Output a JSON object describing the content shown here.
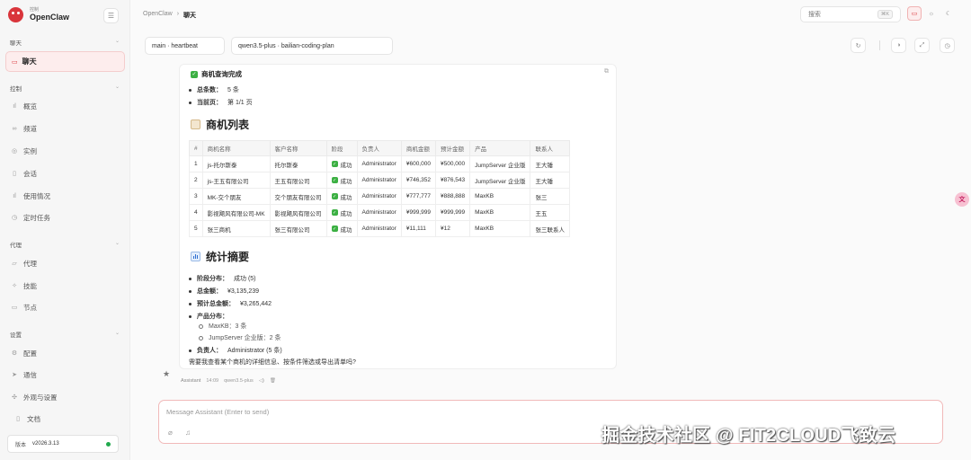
{
  "brand": {
    "sub": "控制",
    "name": "OpenClaw"
  },
  "sidebar": {
    "sections": [
      {
        "label": "聊天"
      },
      {
        "label": "控制"
      },
      {
        "label": "代理"
      },
      {
        "label": "设置"
      }
    ],
    "active_item": {
      "label": "聊天",
      "icon": "chat-bubble-icon"
    },
    "control_items": [
      {
        "label": "概览",
        "icon": "bar-chart-icon"
      },
      {
        "label": "频道",
        "icon": "link-icon"
      },
      {
        "label": "实例",
        "icon": "radio-icon"
      },
      {
        "label": "会话",
        "icon": "file-icon"
      },
      {
        "label": "使用情况",
        "icon": "bar-chart-icon"
      },
      {
        "label": "定时任务",
        "icon": "clock-icon"
      }
    ],
    "agent_items": [
      {
        "label": "代理",
        "icon": "folder-icon"
      },
      {
        "label": "技能",
        "icon": "sparkle-icon"
      },
      {
        "label": "节点",
        "icon": "monitor-icon"
      }
    ],
    "settings_items": [
      {
        "label": "配置",
        "icon": "gear-icon"
      },
      {
        "label": "通信",
        "icon": "send-icon"
      },
      {
        "label": "外观与设置",
        "icon": "palette-icon"
      }
    ],
    "docs": {
      "label": "文档",
      "icon": "book-icon"
    },
    "version": {
      "label": "版本",
      "value": "v2026.3.13"
    }
  },
  "header": {
    "breadcrumb_parent": "OpenClaw",
    "breadcrumb_current": "聊天",
    "search_placeholder": "搜索",
    "search_shortcut": "⌘K"
  },
  "toolbar": {
    "session": "main · heartbeat",
    "model": "qwen3.5-plus · bailian-coding-plan"
  },
  "message": {
    "status": "商机查询完成",
    "stats": [
      {
        "k": "总条数：",
        "v": "5 条"
      },
      {
        "k": "当前页：",
        "v": "第 1/1 页"
      }
    ],
    "list_title": "商机列表",
    "table": {
      "headers": [
        "#",
        "商机名称",
        "客户名称",
        "阶段",
        "负责人",
        "商机金额",
        "预计金额",
        "产品",
        "联系人"
      ],
      "rows": [
        [
          "1",
          "js-托尔斯泰",
          "托尔斯泰",
          "成功",
          "Administrator",
          "¥600,000",
          "¥500,000",
          "JumpServer 企业版",
          "王大锤"
        ],
        [
          "2",
          "js-王五有限公司",
          "王五有限公司",
          "成功",
          "Administrator",
          "¥746,352",
          "¥876,543",
          "JumpServer 企业版",
          "王大锤"
        ],
        [
          "3",
          "MK-交个朋友",
          "交个朋友有限公司",
          "成功",
          "Administrator",
          "¥777,777",
          "¥888,888",
          "MaxKB",
          "张三"
        ],
        [
          "4",
          "影视飓风有限公司-MK",
          "影视飓风有限公司",
          "成功",
          "Administrator",
          "¥999,999",
          "¥999,999",
          "MaxKB",
          "王五"
        ],
        [
          "5",
          "张三商机",
          "张三有限公司",
          "成功",
          "Administrator",
          "¥11,111",
          "¥12",
          "MaxKB",
          "张三联系人"
        ]
      ]
    },
    "summary_title": "统计摘要",
    "summary": {
      "stage_k": "阶段分布：",
      "stage_v": "成功 (5)",
      "total_k": "总金额：",
      "total_v": "¥3,135,239",
      "expected_k": "预计总金额：",
      "expected_v": "¥3,265,442",
      "product_k": "产品分布：",
      "products": [
        "MaxKB：3 条",
        "JumpServer 企业版：2 条"
      ],
      "owner_k": "负责人：",
      "owner_v": "Administrator (5 条)"
    },
    "closing": "需要我查看某个商机的详细信息、按条件筛选或导出清单吗?",
    "meta_author": "Assistant",
    "meta_time": "14:09",
    "meta_model": "qwen3.5-plus"
  },
  "composer": {
    "placeholder": "Message Assistant (Enter to send)"
  },
  "watermark": "掘金技术社区 @ FIT2CLOUD飞致云",
  "colors": {
    "accent": "#d9353b",
    "success": "#3cb043",
    "online": "#21a94d"
  }
}
